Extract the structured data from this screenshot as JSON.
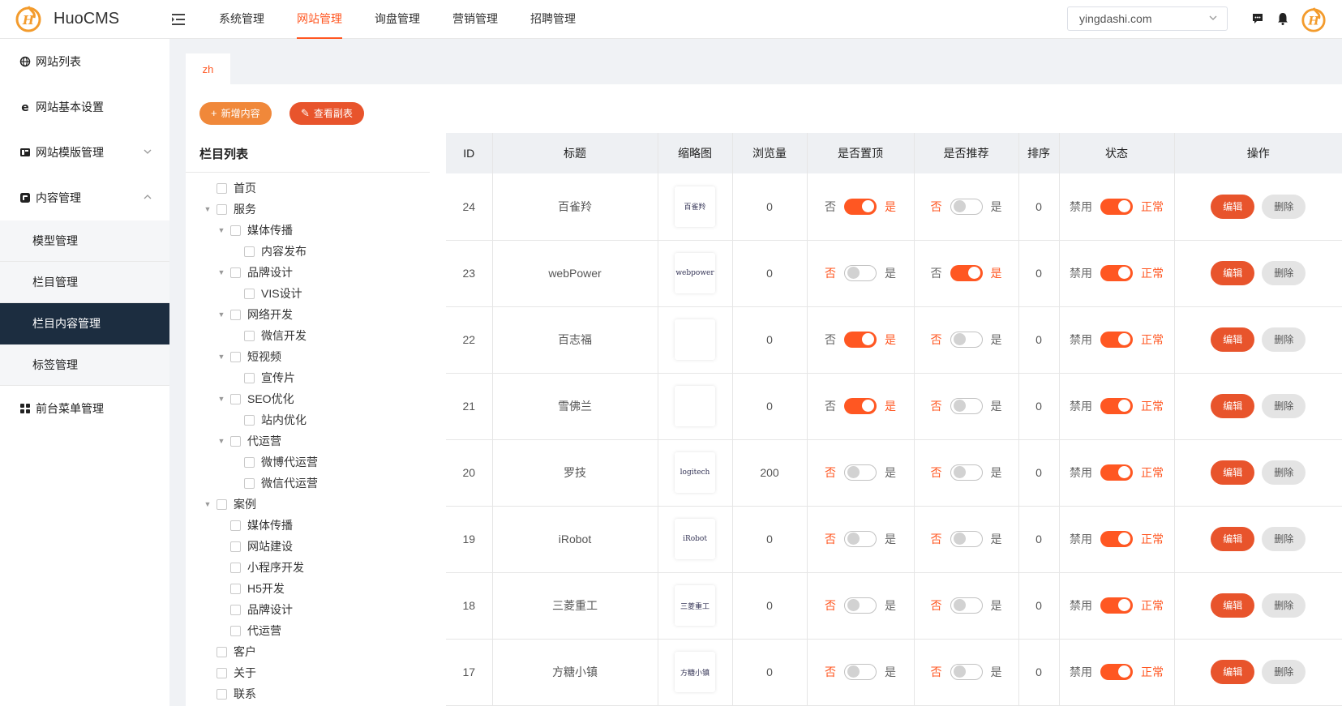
{
  "app": {
    "title": "HuoCMS"
  },
  "topnav": [
    {
      "label": "系统管理",
      "active": false
    },
    {
      "label": "网站管理",
      "active": true
    },
    {
      "label": "询盘管理",
      "active": false
    },
    {
      "label": "营销管理",
      "active": false
    },
    {
      "label": "招聘管理",
      "active": false
    }
  ],
  "domain_select": {
    "value": "yingdashi.com"
  },
  "sidebar": {
    "items": [
      {
        "label": "网站列表",
        "icon": "globe-icon"
      },
      {
        "label": "网站基本设置",
        "icon": "ie-icon"
      },
      {
        "label": "网站模版管理",
        "icon": "template-icon",
        "arrow": "chevron-down-icon"
      },
      {
        "label": "内容管理",
        "icon": "content-icon",
        "arrow": "chevron-up-icon"
      }
    ],
    "sub_items": [
      {
        "label": "模型管理",
        "active": false
      },
      {
        "label": "栏目管理",
        "active": false
      },
      {
        "label": "栏目内容管理",
        "active": true
      },
      {
        "label": "标签管理",
        "active": false
      }
    ],
    "last_item": {
      "label": "前台菜单管理",
      "icon": "grid-icon"
    }
  },
  "tab": {
    "label": "zh"
  },
  "buttons": {
    "add": "新增内容",
    "view": "查看副表"
  },
  "tree": {
    "title": "栏目列表",
    "nodes": [
      {
        "label": "首页",
        "level": 1,
        "caret": false
      },
      {
        "label": "服务",
        "level": 1,
        "caret": true
      },
      {
        "label": "媒体传播",
        "level": 2,
        "caret": true
      },
      {
        "label": "内容发布",
        "level": 3,
        "caret": false
      },
      {
        "label": "品牌设计",
        "level": 2,
        "caret": true
      },
      {
        "label": "VIS设计",
        "level": 3,
        "caret": false
      },
      {
        "label": "网络开发",
        "level": 2,
        "caret": true
      },
      {
        "label": "微信开发",
        "level": 3,
        "caret": false
      },
      {
        "label": "短视频",
        "level": 2,
        "caret": true
      },
      {
        "label": "宣传片",
        "level": 3,
        "caret": false
      },
      {
        "label": "SEO优化",
        "level": 2,
        "caret": true
      },
      {
        "label": "站内优化",
        "level": 3,
        "caret": false
      },
      {
        "label": "代运营",
        "level": 2,
        "caret": true
      },
      {
        "label": "微博代运营",
        "level": 3,
        "caret": false
      },
      {
        "label": "微信代运营",
        "level": 3,
        "caret": false
      },
      {
        "label": "案例",
        "level": 1,
        "caret": true
      },
      {
        "label": "媒体传播",
        "level": 2,
        "caret": false
      },
      {
        "label": "网站建设",
        "level": 2,
        "caret": false
      },
      {
        "label": "小程序开发",
        "level": 2,
        "caret": false
      },
      {
        "label": "H5开发",
        "level": 2,
        "caret": false
      },
      {
        "label": "品牌设计",
        "level": 2,
        "caret": false
      },
      {
        "label": "代运营",
        "level": 2,
        "caret": false
      },
      {
        "label": "客户",
        "level": 1,
        "caret": false
      },
      {
        "label": "关于",
        "level": 1,
        "caret": false
      },
      {
        "label": "联系",
        "level": 1,
        "caret": false
      }
    ]
  },
  "table": {
    "headers": [
      "ID",
      "标题",
      "缩略图",
      "浏览量",
      "是否置顶",
      "是否推荐",
      "排序",
      "状态",
      "操作"
    ],
    "toggle_labels": {
      "no": "否",
      "yes": "是",
      "disabled": "禁用",
      "normal": "正常"
    },
    "actions": {
      "edit": "编辑",
      "delete": "删除"
    },
    "rows": [
      {
        "id": "24",
        "title": "百雀羚",
        "thumb": "百雀羚",
        "views": "0",
        "top": true,
        "recommend": false,
        "sort": "0",
        "status": true
      },
      {
        "id": "23",
        "title": "webPower",
        "thumb": "webpower",
        "views": "0",
        "top": false,
        "recommend": true,
        "sort": "0",
        "status": true
      },
      {
        "id": "22",
        "title": "百志福",
        "thumb": "",
        "views": "0",
        "top": true,
        "recommend": false,
        "sort": "0",
        "status": true
      },
      {
        "id": "21",
        "title": "雪佛兰",
        "thumb": "",
        "views": "0",
        "top": true,
        "recommend": false,
        "sort": "0",
        "status": true
      },
      {
        "id": "20",
        "title": "罗技",
        "thumb": "logitech",
        "views": "200",
        "top": false,
        "recommend": false,
        "sort": "0",
        "status": true
      },
      {
        "id": "19",
        "title": "iRobot",
        "thumb": "iRobot",
        "views": "0",
        "top": false,
        "recommend": false,
        "sort": "0",
        "status": true
      },
      {
        "id": "18",
        "title": "三菱重工",
        "thumb": "三菱重工",
        "views": "0",
        "top": false,
        "recommend": false,
        "sort": "0",
        "status": true
      },
      {
        "id": "17",
        "title": "方糖小镇",
        "thumb": "方糖小镇",
        "views": "0",
        "top": false,
        "recommend": false,
        "sort": "0",
        "status": true
      }
    ]
  },
  "colors": {
    "accent": "#ff5722",
    "sidebar_active": "#1c2d40",
    "add_button": "#f0883a",
    "view_button": "#e8542c"
  }
}
